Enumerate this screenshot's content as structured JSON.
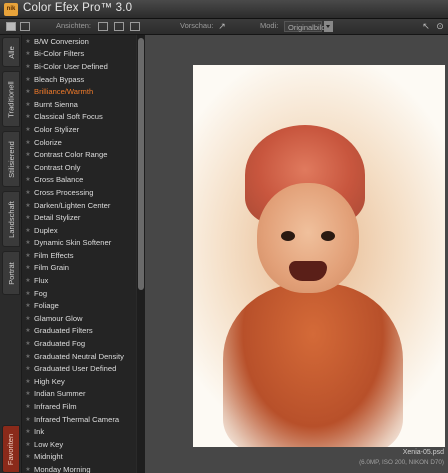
{
  "app": {
    "logo_text": "nik",
    "title": "Color Efex Pro™ 3.0"
  },
  "toolbar": {
    "view_label": "Ansichten:",
    "preview_label": "Vorschau:",
    "mode_label": "Modi:",
    "mode_value": "Originalbild"
  },
  "tabs": [
    "Alle",
    "Traditionell",
    "Stilisierend",
    "Landschaft",
    "Porträt",
    "Favoriten"
  ],
  "filters": {
    "selected_index": 4,
    "items": [
      "B/W Conversion",
      "Bi-Color Filters",
      "Bi-Color User Defined",
      "Bleach Bypass",
      "Brilliance/Warmth",
      "Burnt Sienna",
      "Classical Soft Focus",
      "Color Stylizer",
      "Colorize",
      "Contrast Color Range",
      "Contrast Only",
      "Cross Balance",
      "Cross Processing",
      "Darken/Lighten Center",
      "Detail Stylizer",
      "Duplex",
      "Dynamic Skin Softener",
      "Film Effects",
      "Film Grain",
      "Flux",
      "Fog",
      "Foliage",
      "Glamour Glow",
      "Graduated Filters",
      "Graduated Fog",
      "Graduated Neutral Density",
      "Graduated User Defined",
      "High Key",
      "Indian Summer",
      "Infrared Film",
      "Infrared Thermal Camera",
      "Ink",
      "Low Key",
      "Midnight",
      "Monday Morning"
    ]
  },
  "image_info": {
    "filename": "Xenia-05.psd",
    "details": "(6.0MP, ISO 200, NIKON D70)"
  },
  "colors": {
    "accent": "#f07a2a",
    "favorites_tab": "#8a2a1a"
  }
}
